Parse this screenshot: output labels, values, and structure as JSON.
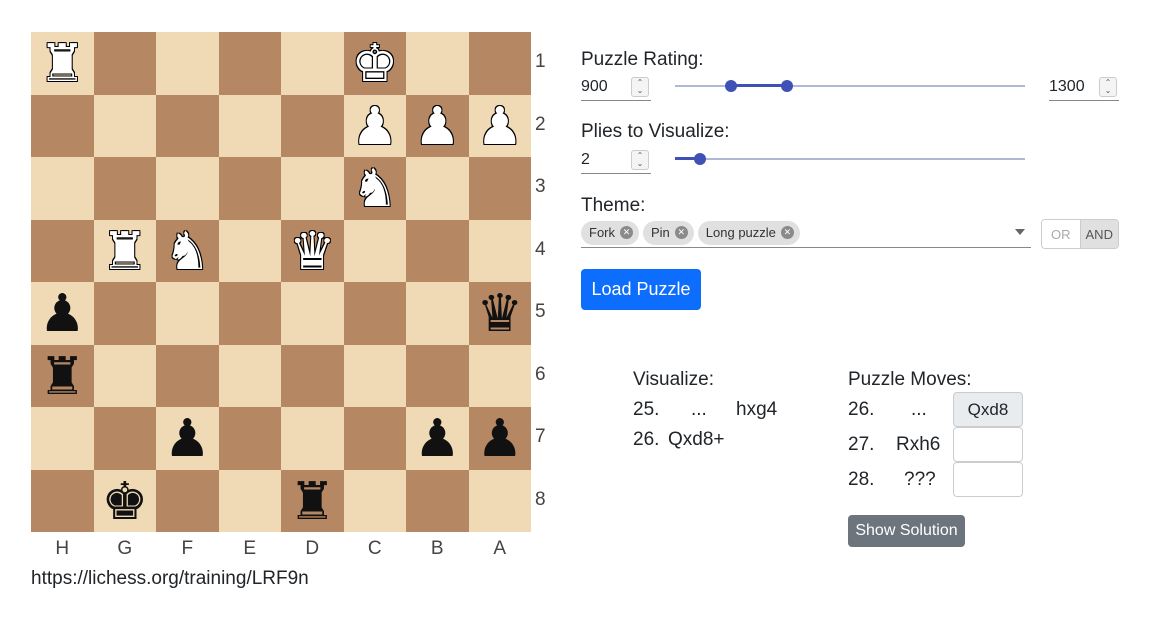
{
  "board": {
    "files": [
      "H",
      "G",
      "F",
      "E",
      "D",
      "C",
      "B",
      "A"
    ],
    "ranks": [
      "1",
      "2",
      "3",
      "4",
      "5",
      "6",
      "7",
      "8"
    ],
    "pieces": [
      {
        "square": "h1",
        "color": "w",
        "type": "rook"
      },
      {
        "square": "c1",
        "color": "w",
        "type": "king"
      },
      {
        "square": "c2",
        "color": "w",
        "type": "pawn"
      },
      {
        "square": "b2",
        "color": "w",
        "type": "pawn"
      },
      {
        "square": "a2",
        "color": "w",
        "type": "pawn"
      },
      {
        "square": "c3",
        "color": "w",
        "type": "knight"
      },
      {
        "square": "g4",
        "color": "w",
        "type": "rook"
      },
      {
        "square": "f4",
        "color": "w",
        "type": "knight"
      },
      {
        "square": "d4",
        "color": "w",
        "type": "queen"
      },
      {
        "square": "h5",
        "color": "b",
        "type": "pawn"
      },
      {
        "square": "a5",
        "color": "b",
        "type": "queen"
      },
      {
        "square": "h6",
        "color": "b",
        "type": "rook"
      },
      {
        "square": "f7",
        "color": "b",
        "type": "pawn"
      },
      {
        "square": "b7",
        "color": "b",
        "type": "pawn"
      },
      {
        "square": "a7",
        "color": "b",
        "type": "pawn"
      },
      {
        "square": "g8",
        "color": "b",
        "type": "king"
      },
      {
        "square": "d8",
        "color": "b",
        "type": "rook"
      }
    ],
    "light_color": "#f0d9b5",
    "dark_color": "#b58863"
  },
  "puzzle_link": "https://lichess.org/training/LRF9n",
  "controls": {
    "rating": {
      "label": "Puzzle Rating:",
      "min_value": "900",
      "max_value": "1300",
      "slider_low_fraction": 0.16,
      "slider_high_fraction": 0.32
    },
    "plies": {
      "label": "Plies to Visualize:",
      "value": "2",
      "slider_fraction": 0.07
    },
    "theme": {
      "label": "Theme:",
      "chips": [
        "Fork",
        "Pin",
        "Long puzzle"
      ],
      "logic_or": "OR",
      "logic_and": "AND",
      "selected_logic": "AND"
    },
    "load_button": "Load Puzzle"
  },
  "visualize": {
    "title": "Visualize:",
    "moves": [
      {
        "num": "25.",
        "white": "...",
        "black": "hxg4"
      },
      {
        "num": "26.",
        "white": "Qxd8+",
        "black": ""
      }
    ]
  },
  "puzzle_moves": {
    "title": "Puzzle Moves:",
    "rows": [
      {
        "num": "26.",
        "opponent": "...",
        "answer": "Qxd8"
      },
      {
        "num": "27.",
        "opponent": "Rxh6",
        "answer": ""
      },
      {
        "num": "28.",
        "opponent": "???",
        "answer": ""
      }
    ],
    "show_solution": "Show Solution"
  },
  "accent_color": "#3f51b5",
  "primary_button_color": "#0d6efd"
}
